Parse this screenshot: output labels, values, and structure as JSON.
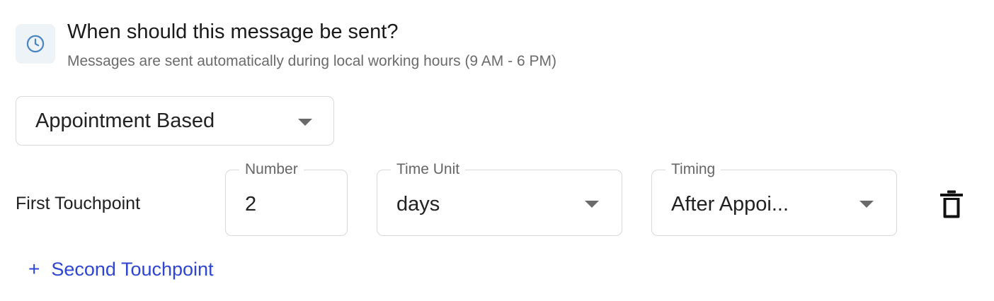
{
  "header": {
    "icon": "clock-icon",
    "title": "When should this message be sent?",
    "subtitle": "Messages are sent automatically during local working hours (9 AM - 6 PM)"
  },
  "mode": {
    "selected": "Appointment Based"
  },
  "touchpoint": {
    "label": "First Touchpoint",
    "number": {
      "label": "Number",
      "value": "2"
    },
    "time_unit": {
      "label": "Time Unit",
      "value": "days"
    },
    "timing": {
      "label": "Timing",
      "value": "After Appoi..."
    },
    "delete_icon": "trash-icon"
  },
  "add": {
    "icon": "plus-icon",
    "label": "Second Touchpoint"
  },
  "colors": {
    "accent": "#2f45d4",
    "clock": "#4a86c5",
    "badge_bg": "#eef3f8",
    "border": "#d9d9d9"
  }
}
